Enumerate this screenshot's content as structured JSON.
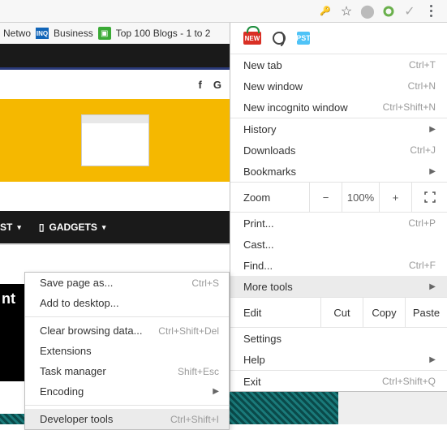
{
  "toolbar": {
    "key_icon": "🔑",
    "star_icon": "☆",
    "globe_icon": "●",
    "check_icon": "✓"
  },
  "bookmarks": {
    "item1": "Netwo",
    "item2": "Business",
    "item3": "Top 100 Blogs - 1 to 2"
  },
  "page": {
    "social_f": "f",
    "social_g": "G",
    "nav_item1": "ST",
    "nav_item2": "GADGETS",
    "bottom_text": "nt"
  },
  "main_menu": {
    "ext_new": "NEW",
    "ext_blue": "PST",
    "new_tab": "New tab",
    "new_tab_sc": "Ctrl+T",
    "new_window": "New window",
    "new_window_sc": "Ctrl+N",
    "incognito": "New incognito window",
    "incognito_sc": "Ctrl+Shift+N",
    "history": "History",
    "downloads": "Downloads",
    "downloads_sc": "Ctrl+J",
    "bookmarks": "Bookmarks",
    "zoom": "Zoom",
    "zoom_minus": "−",
    "zoom_pct": "100%",
    "zoom_plus": "+",
    "print": "Print...",
    "print_sc": "Ctrl+P",
    "cast": "Cast...",
    "find": "Find...",
    "find_sc": "Ctrl+F",
    "more_tools": "More tools",
    "edit": "Edit",
    "cut": "Cut",
    "copy": "Copy",
    "paste": "Paste",
    "settings": "Settings",
    "help": "Help",
    "exit": "Exit",
    "exit_sc": "Ctrl+Shift+Q"
  },
  "sub_menu": {
    "save_page": "Save page as...",
    "save_page_sc": "Ctrl+S",
    "add_desktop": "Add to desktop...",
    "clear_data": "Clear browsing data...",
    "clear_data_sc": "Ctrl+Shift+Del",
    "extensions": "Extensions",
    "task_manager": "Task manager",
    "task_manager_sc": "Shift+Esc",
    "encoding": "Encoding",
    "dev_tools": "Developer tools",
    "dev_tools_sc": "Ctrl+Shift+I"
  }
}
